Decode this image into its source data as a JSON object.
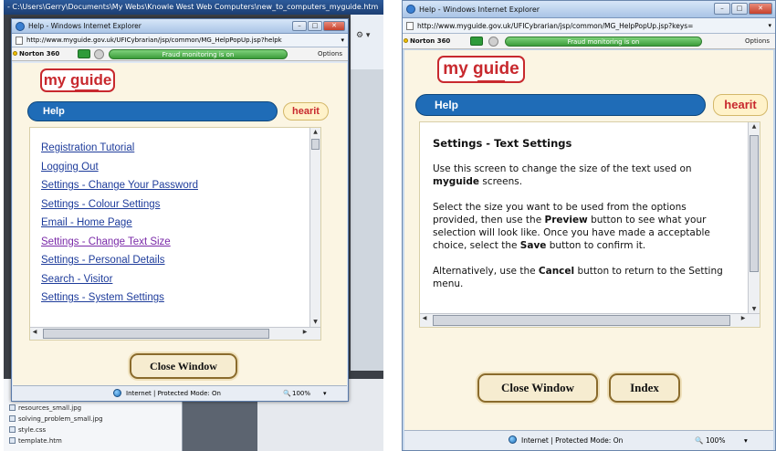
{
  "left_screenshot": {
    "background_window_title": "- C:\\Users\\Gerry\\Documents\\My Webs\\Knowle West Web Computers\\new_to_computers_myguide.htm",
    "file_list": [
      "resources_small.jpg",
      "solving_problem_small.jpg",
      "style.css",
      "template.htm"
    ],
    "popup": {
      "title": "Help - Windows Internet Explorer",
      "address": "http://www.myguide.gov.uk/UFICybrarian/jsp/common/MG_HelpPopUp.jsp?helpk",
      "norton_label": "Norton 360",
      "fraud_text": "Fraud monitoring is on",
      "options_label": "Options",
      "logo_text": "my guide",
      "help_label": "Help",
      "hearit_label": "hearit",
      "links": [
        "Registration Tutorial",
        "Logging Out",
        "Settings - Change Your Password",
        "Settings - Colour Settings",
        "Email - Home Page",
        "Settings - Change Text Size",
        "Settings - Personal Details",
        "Search - Visitor",
        "Settings - System Settings"
      ],
      "close_button": "Close Window",
      "status_text": "Internet | Protected Mode: On",
      "zoom": "100%"
    }
  },
  "right_screenshot": {
    "popup": {
      "title": "Help - Windows Internet Explorer",
      "address": "http://www.myguide.gov.uk/UFICybrarian/jsp/common/MG_HelpPopUp.jsp?keys=",
      "norton_label": "Norton 360",
      "fraud_text": "Fraud monitoring is on",
      "options_label": "Options",
      "logo_text": "my guide",
      "help_label": "Help",
      "hearit_label": "hearit",
      "heading": "Settings - Text Settings",
      "para1_line1": "Use this screen to change the size of the text used on",
      "para1_bold": "myguide",
      "para1_line2_rest": " screens.",
      "para2_line1": "Select the size you want to be used from the options",
      "para2_line2_a": "provided, then use the ",
      "para2_preview": "Preview",
      "para2_line2_b": " button to see what your",
      "para2_line3": "selection will look like. Once you have made a acceptable",
      "para2_line4_a": "choice, select the ",
      "para2_save": "Save",
      "para2_line4_b": " button to confirm it.",
      "para3_line1_a": "Alternatively, use the ",
      "para3_cancel": "Cancel",
      "para3_line1_b": " button to return to the Setting",
      "para3_line2": "menu.",
      "close_button": "Close Window",
      "index_button": "Index",
      "status_text": "Internet | Protected Mode: On",
      "zoom": "100%"
    }
  }
}
